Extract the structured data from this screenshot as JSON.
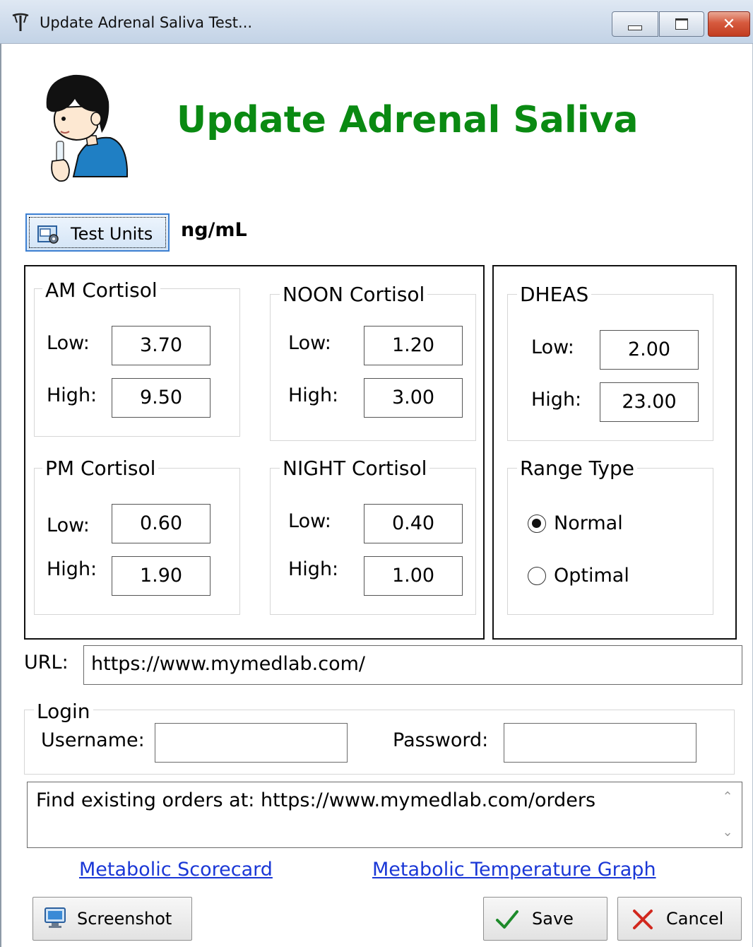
{
  "window": {
    "title": "Update Adrenal Saliva Test...",
    "minimize_label": "minimize",
    "maximize_label": "maximize",
    "close_symbol": "✕"
  },
  "header": {
    "title": "Update Adrenal Saliva",
    "title_color": "#0a8a12",
    "illustration": "child-saliva-test-illustration"
  },
  "toolbar": {
    "test_units_button": "Test Units",
    "test_units_icon": "units-settings-icon",
    "units_value": "ng/mL"
  },
  "cortisol": {
    "am": {
      "title": "AM Cortisol",
      "low_label": "Low:",
      "low": "3.70",
      "high_label": "High:",
      "high": "9.50"
    },
    "noon": {
      "title": "NOON Cortisol",
      "low_label": "Low:",
      "low": "1.20",
      "high_label": "High:",
      "high": "3.00"
    },
    "pm": {
      "title": "PM Cortisol",
      "low_label": "Low:",
      "low": "0.60",
      "high_label": "High:",
      "high": "1.90"
    },
    "night": {
      "title": "NIGHT Cortisol",
      "low_label": "Low:",
      "low": "0.40",
      "high_label": "High:",
      "high": "1.00"
    }
  },
  "dheas": {
    "title": "DHEAS",
    "low_label": "Low:",
    "low": "2.00",
    "high_label": "High:",
    "high": "23.00"
  },
  "range_type": {
    "title": "Range Type",
    "options": [
      {
        "label": "Normal",
        "selected": true
      },
      {
        "label": "Optimal",
        "selected": false
      }
    ]
  },
  "url": {
    "label": "URL:",
    "value": "https://www.mymedlab.com/"
  },
  "login": {
    "title": "Login",
    "username_label": "Username:",
    "username_value": "",
    "password_label": "Password:",
    "password_value": ""
  },
  "notes": {
    "text": "Find existing orders at: https://www.mymedlab.com/orders"
  },
  "links": {
    "scorecard": "Metabolic Scorecard",
    "temperature_graph": "Metabolic Temperature Graph",
    "link_color": "#1a37d6"
  },
  "buttons": {
    "screenshot": "Screenshot",
    "save": "Save",
    "cancel": "Cancel",
    "save_icon": "checkmark-icon",
    "cancel_icon": "x-icon"
  }
}
